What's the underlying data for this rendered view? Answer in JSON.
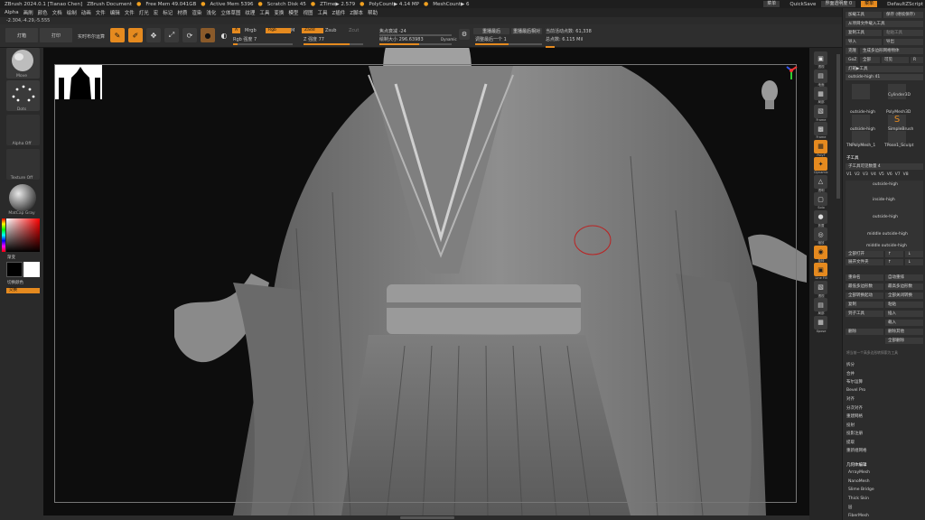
{
  "titlebar": {
    "app": "ZBrush 2024.0.1 [Tianao Chen]",
    "doc": "ZBrush Document",
    "free_mem": "Free Mem 49.041GB",
    "active_mem": "Active Mem 5396",
    "scratch": "Scratch Disk 45",
    "ztime": "ZTime▶ 2.579",
    "polycount": "PolyCount▶ 4.14 MP",
    "meshcount": "MeshCount▶ 6",
    "menus_btn": "菜单",
    "quicksave": "QuickSave",
    "transparency": "界面透明度 0",
    "menu_label": "菜单",
    "zscript": "DefaultZScript"
  },
  "menubar": [
    "Alpha",
    "画刷",
    "颜色",
    "文档",
    "绘制",
    "动画",
    "文件",
    "编辑",
    "文件",
    "灯光",
    "宏",
    "标记",
    "材质",
    "渲染",
    "浅化",
    "立体草图",
    "纹理",
    "工具",
    "变换",
    "模型",
    "视图",
    "工具",
    "Z插件",
    "Z脚本",
    "帮助"
  ],
  "coords": "-2.304,-4.29,-5.555",
  "topshelf": {
    "lightbox": "灯箱",
    "tab2": "打印",
    "live_boolean": "实时布尔运算",
    "edit": "Edit",
    "draw": "Draw",
    "move": "Move",
    "scale": "Scale",
    "rotate": "Rotate",
    "a_tag": "A",
    "mrgb": "Mrgb",
    "rgb": "Rgb",
    "m": "M",
    "rgb_intensity": "Rgb 强度 7",
    "zadd": "Zadd",
    "zsub": "Zsub",
    "z_intensity": "Z 强度 77",
    "focal_shift": "焦点衰减 -24",
    "draw_size": "绘制大小 296.63983",
    "dynamic": "Dynamic",
    "replay_last": "重播最后",
    "replay_last_rel": "重播最后相对",
    "adjust_last": "调整最后一个 1",
    "active_points": "当前活动点数: 61,338",
    "total_points": "总点数: 6.115 Mil",
    "rgb_fill": 0.07,
    "z_fill": 0.77,
    "size_fill": 0.55,
    "adjust_fill": 0.5
  },
  "leftpanel": {
    "brush": "Move",
    "stroke": "Dots",
    "alpha": "Alpha Off",
    "texture": "Texture Off",
    "material": "MatCap Gray",
    "gradient": "渐变",
    "switch_color": "切换颜色",
    "swap": "交换"
  },
  "rightshelf": [
    {
      "icon": "▣",
      "label": "透视"
    },
    {
      "icon": "▤",
      "label": "地面"
    },
    {
      "icon": "▦",
      "label": "局部"
    },
    {
      "icon": "▧",
      "label": "Frame"
    },
    {
      "icon": "▩",
      "label": "Frame"
    },
    {
      "icon": "▦",
      "label": "PolyF"
    },
    {
      "icon": "✦",
      "label": "Dynamic"
    },
    {
      "icon": "△",
      "label": "透明"
    },
    {
      "icon": "▢",
      "label": "Solo"
    },
    {
      "icon": "●",
      "label": "放置"
    },
    {
      "icon": "◎",
      "label": "缩放"
    },
    {
      "icon": "◉",
      "label": "旋转"
    },
    {
      "icon": "▣",
      "label": "Line Fill"
    },
    {
      "icon": "▧",
      "label": "透视"
    },
    {
      "icon": "▤",
      "label": "局部"
    },
    {
      "icon": "▦",
      "label": "Xpose"
    }
  ],
  "tray": {
    "top_buttons": [
      "加载工具",
      "保存 (继续保存)"
    ],
    "row1": [
      "从项目文件载入工具"
    ],
    "row2": [
      "复制工具",
      "粘贴工具"
    ],
    "row3": [
      "导入",
      "导出"
    ],
    "row4": [
      "克隆",
      "生成多边形网格物体"
    ],
    "row5": [
      "GoZ",
      "全部",
      "可见",
      "R"
    ],
    "row6": "灯箱▶工具",
    "current_tool": "outside-high 41",
    "thumbs": [
      "outside-high",
      "Cylinder3D",
      "PolyMesh3D",
      "outside-high",
      "SimpleBrush",
      "TNPolyMesh_1",
      "TPose1_Sculpt"
    ],
    "subtool_header": "子工具",
    "subtool_count": "子工具可见数量 4",
    "versions": [
      "V1",
      "V2",
      "V3",
      "V4",
      "V5",
      "V6",
      "V7",
      "V8"
    ],
    "subtools": [
      "outside-high",
      "inside-high",
      "outside-high",
      "middle outside-high"
    ],
    "subtool_bottom": "middle outside-high",
    "rows_a": [
      [
        "全部打开",
        "↑",
        "↓"
      ],
      [
        "展开文件夹",
        "↑",
        "↓"
      ]
    ],
    "rows_b": [
      [
        "重命名",
        "自动重排"
      ],
      [
        "最低多边形数",
        "最高多边形数"
      ],
      [
        "全部转换起动",
        "全部关闭转换"
      ],
      [
        "复制",
        "粘贴"
      ],
      [
        "到子工具",
        "插入"
      ],
      [
        "",
        "载入"
      ],
      [
        "删除",
        "删除其他"
      ],
      [
        "",
        "全部删除"
      ]
    ],
    "hint": "将当前一个高多边形转探索为工具",
    "list": [
      "拆分",
      "合并",
      "布尔运算",
      "Bevel Pro",
      "对齐",
      "分次对齐",
      "重建网格",
      "投射",
      "投影注册",
      "提取",
      "重新组网格"
    ],
    "list2_header": "几何体编辑",
    "list2": [
      "ArrayMesh",
      "NanoMesh",
      "Slime Bridge",
      "Thick Skin",
      "层",
      "FiberMesh"
    ]
  }
}
